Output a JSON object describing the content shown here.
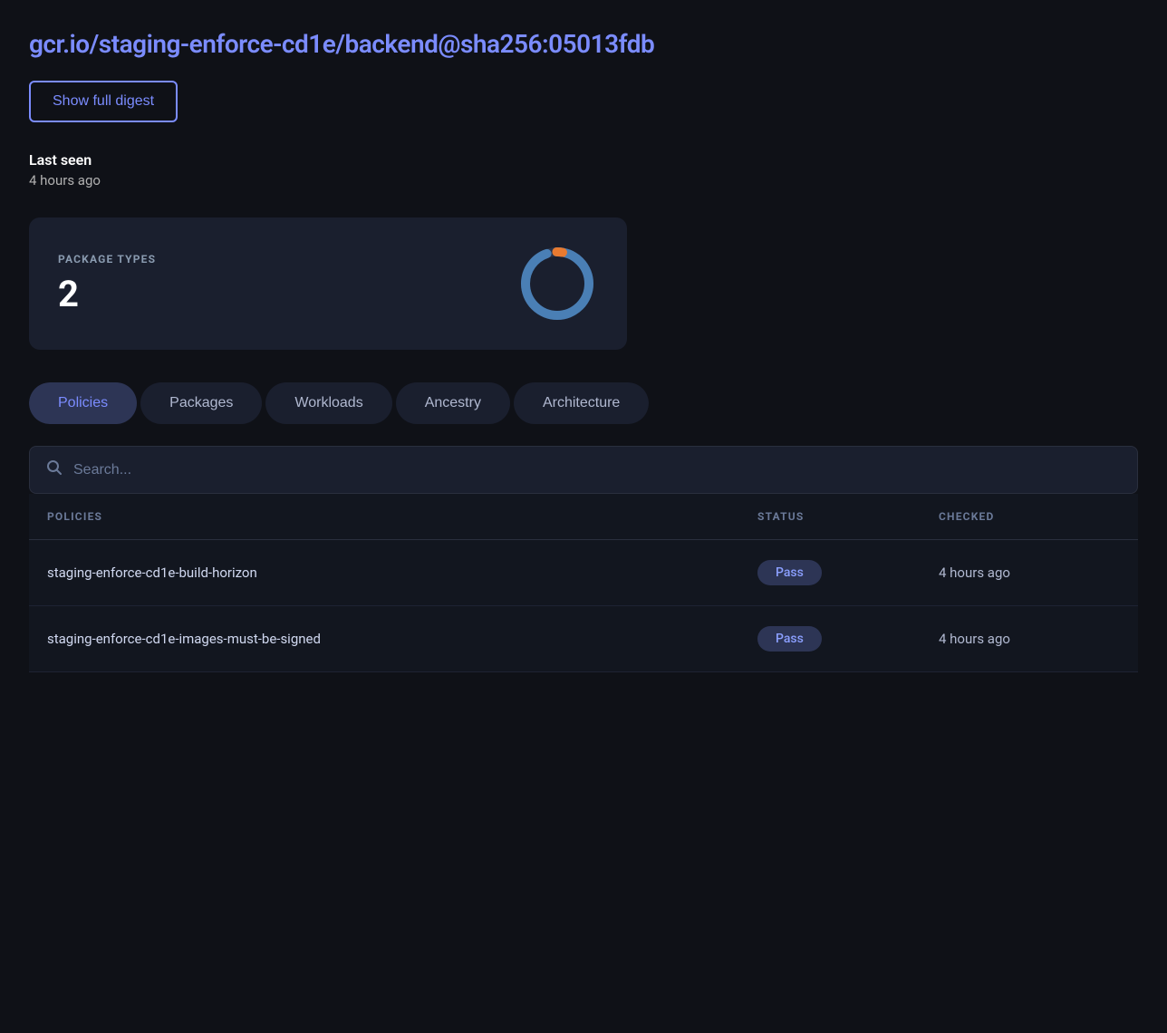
{
  "header": {
    "title": "gcr.io/staging-enforce-cd1e/backend@sha256:05013fdb",
    "show_digest_label": "Show full digest"
  },
  "last_seen": {
    "label": "Last seen",
    "value": "4 hours ago"
  },
  "package_types": {
    "label": "PACKAGE TYPES",
    "count": "2"
  },
  "tabs": [
    {
      "label": "Policies",
      "active": true
    },
    {
      "label": "Packages",
      "active": false
    },
    {
      "label": "Workloads",
      "active": false
    },
    {
      "label": "Ancestry",
      "active": false
    },
    {
      "label": "Architecture",
      "active": false
    }
  ],
  "search": {
    "placeholder": "Search..."
  },
  "table": {
    "columns": [
      {
        "label": "POLICIES"
      },
      {
        "label": "STATUS"
      },
      {
        "label": "CHECKED"
      }
    ],
    "rows": [
      {
        "policy": "staging-enforce-cd1e-build-horizon",
        "status": "Pass",
        "checked": "4 hours ago"
      },
      {
        "policy": "staging-enforce-cd1e-images-must-be-signed",
        "status": "Pass",
        "checked": "4 hours ago"
      }
    ]
  },
  "donut": {
    "main_color": "#4a7fb5",
    "accent_color": "#e87a30",
    "bg_color": "#1a1f2e"
  }
}
